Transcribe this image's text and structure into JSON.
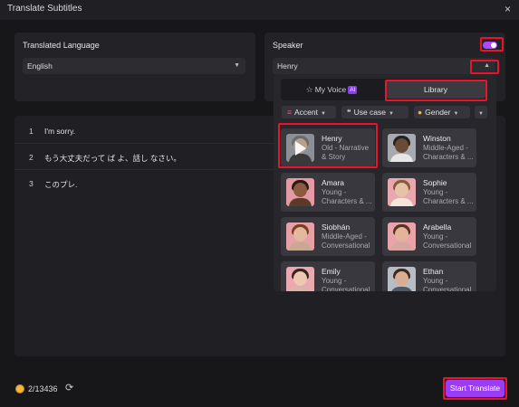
{
  "window": {
    "title": "Translate Subtitles",
    "close_icon": "×"
  },
  "language_card": {
    "label": "Translated Language",
    "selected": "English"
  },
  "speaker_card": {
    "label": "Speaker",
    "selected": "Henry",
    "toggle_on": true
  },
  "subtitles": [
    {
      "num": "1",
      "text": "I'm sorry."
    },
    {
      "num": "2",
      "text": "もう大丈夫だって ば よ、話し なさい。"
    },
    {
      "num": "3",
      "text": "このプレ."
    }
  ],
  "voice_panel": {
    "tabs": {
      "my_voice": "My Voice",
      "ai_badge": "AI",
      "library": "Library"
    },
    "filters": {
      "accent": "Accent",
      "use_case": "Use case",
      "gender": "Gender"
    },
    "voices": [
      {
        "name": "Henry",
        "desc": "Old - Narrative & Story",
        "selected": true,
        "skin": "#b9a08c",
        "hair": "#6b6b6b",
        "body": "#3a3a3a",
        "bg": "#8c8f96"
      },
      {
        "name": "Winston",
        "desc": "Middle-Aged - Characters & ...",
        "selected": false,
        "skin": "#6b4a35",
        "hair": "#222222",
        "body": "#e6e6e6",
        "bg": "#a8aab0"
      },
      {
        "name": "Amara",
        "desc": "Young - Characters & ...",
        "selected": false,
        "skin": "#8a5b3f",
        "hair": "#2b1a12",
        "body": "#5c3a2a",
        "bg": "#e39aa5"
      },
      {
        "name": "Sophie",
        "desc": "Young - Characters & ...",
        "selected": false,
        "skin": "#e6c2aa",
        "hair": "#8a5a34",
        "body": "#f2e6dc",
        "bg": "#e9a7b0"
      },
      {
        "name": "Siobhán",
        "desc": "Middle-Aged - Conversational",
        "selected": false,
        "skin": "#e2b89e",
        "hair": "#7a3f22",
        "body": "#c8a890",
        "bg": "#e5a0a8"
      },
      {
        "name": "Arabella",
        "desc": "Young - Conversational",
        "selected": false,
        "skin": "#e2b49a",
        "hair": "#5a3220",
        "body": "#d6a7a0",
        "bg": "#e8a3ab"
      },
      {
        "name": "Emily",
        "desc": "Young - Conversational",
        "selected": false,
        "skin": "#edc8b0",
        "hair": "#3a2418",
        "body": "#d8b6a6",
        "bg": "#eaa8b0"
      },
      {
        "name": "Ethan",
        "desc": "Young - Conversational",
        "selected": false,
        "skin": "#d8ad92",
        "hair": "#3b2a20",
        "body": "#505a66",
        "bg": "#b8bcc4"
      }
    ]
  },
  "footer": {
    "credits": "2/13436",
    "start_button": "Start Translate"
  },
  "colors": {
    "accent": "#9a3df5",
    "highlight": "#e8142a",
    "background": "#17171a"
  }
}
